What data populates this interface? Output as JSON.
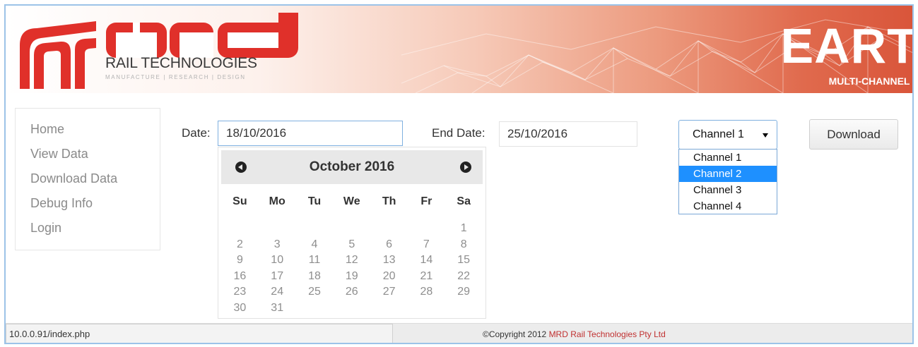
{
  "header": {
    "logo_word": "mrd",
    "logo_tagline": "RAIL TECHNOLOGIES",
    "logo_subline": "MANUFACTURE  |  RESEARCH  |  DESIGN",
    "brand_title": "EART",
    "brand_subtitle": "MULTI-CHANNEL I",
    "colors": {
      "brand_red": "#e0302a",
      "banner_end": "#d9553a"
    }
  },
  "nav": {
    "items": [
      {
        "label": "Home"
      },
      {
        "label": "View Data"
      },
      {
        "label": "Download Data"
      },
      {
        "label": "Debug Info"
      },
      {
        "label": "Login"
      }
    ]
  },
  "form": {
    "date_label": "Date:",
    "date_value": "18/10/2016",
    "end_date_label": "End Date:",
    "end_date_value": "25/10/2016",
    "download_label": "Download"
  },
  "calendar": {
    "title": "October 2016",
    "prev_icon": "chevron-left-circle-icon",
    "next_icon": "chevron-right-circle-icon",
    "days_of_week": [
      "Su",
      "Mo",
      "Tu",
      "We",
      "Th",
      "Fr",
      "Sa"
    ],
    "weeks": [
      [
        "",
        "",
        "",
        "",
        "",
        "",
        "1"
      ],
      [
        "2",
        "3",
        "4",
        "5",
        "6",
        "7",
        "8"
      ],
      [
        "9",
        "10",
        "11",
        "12",
        "13",
        "14",
        "15"
      ],
      [
        "16",
        "17",
        "18",
        "19",
        "20",
        "21",
        "22"
      ],
      [
        "23",
        "24",
        "25",
        "26",
        "27",
        "28",
        "29"
      ],
      [
        "30",
        "31",
        "",
        "",
        "",
        "",
        ""
      ]
    ]
  },
  "channel_select": {
    "selected": "Channel 1",
    "highlighted_index": 1,
    "options": [
      "Channel 1",
      "Channel 2",
      "Channel 3",
      "Channel 4"
    ]
  },
  "footer": {
    "status_url": "10.0.0.91/index.php",
    "copyright_prefix": "©Copyright 2012 ",
    "copyright_company": "MRD Rail Technologies Pty Ltd"
  }
}
